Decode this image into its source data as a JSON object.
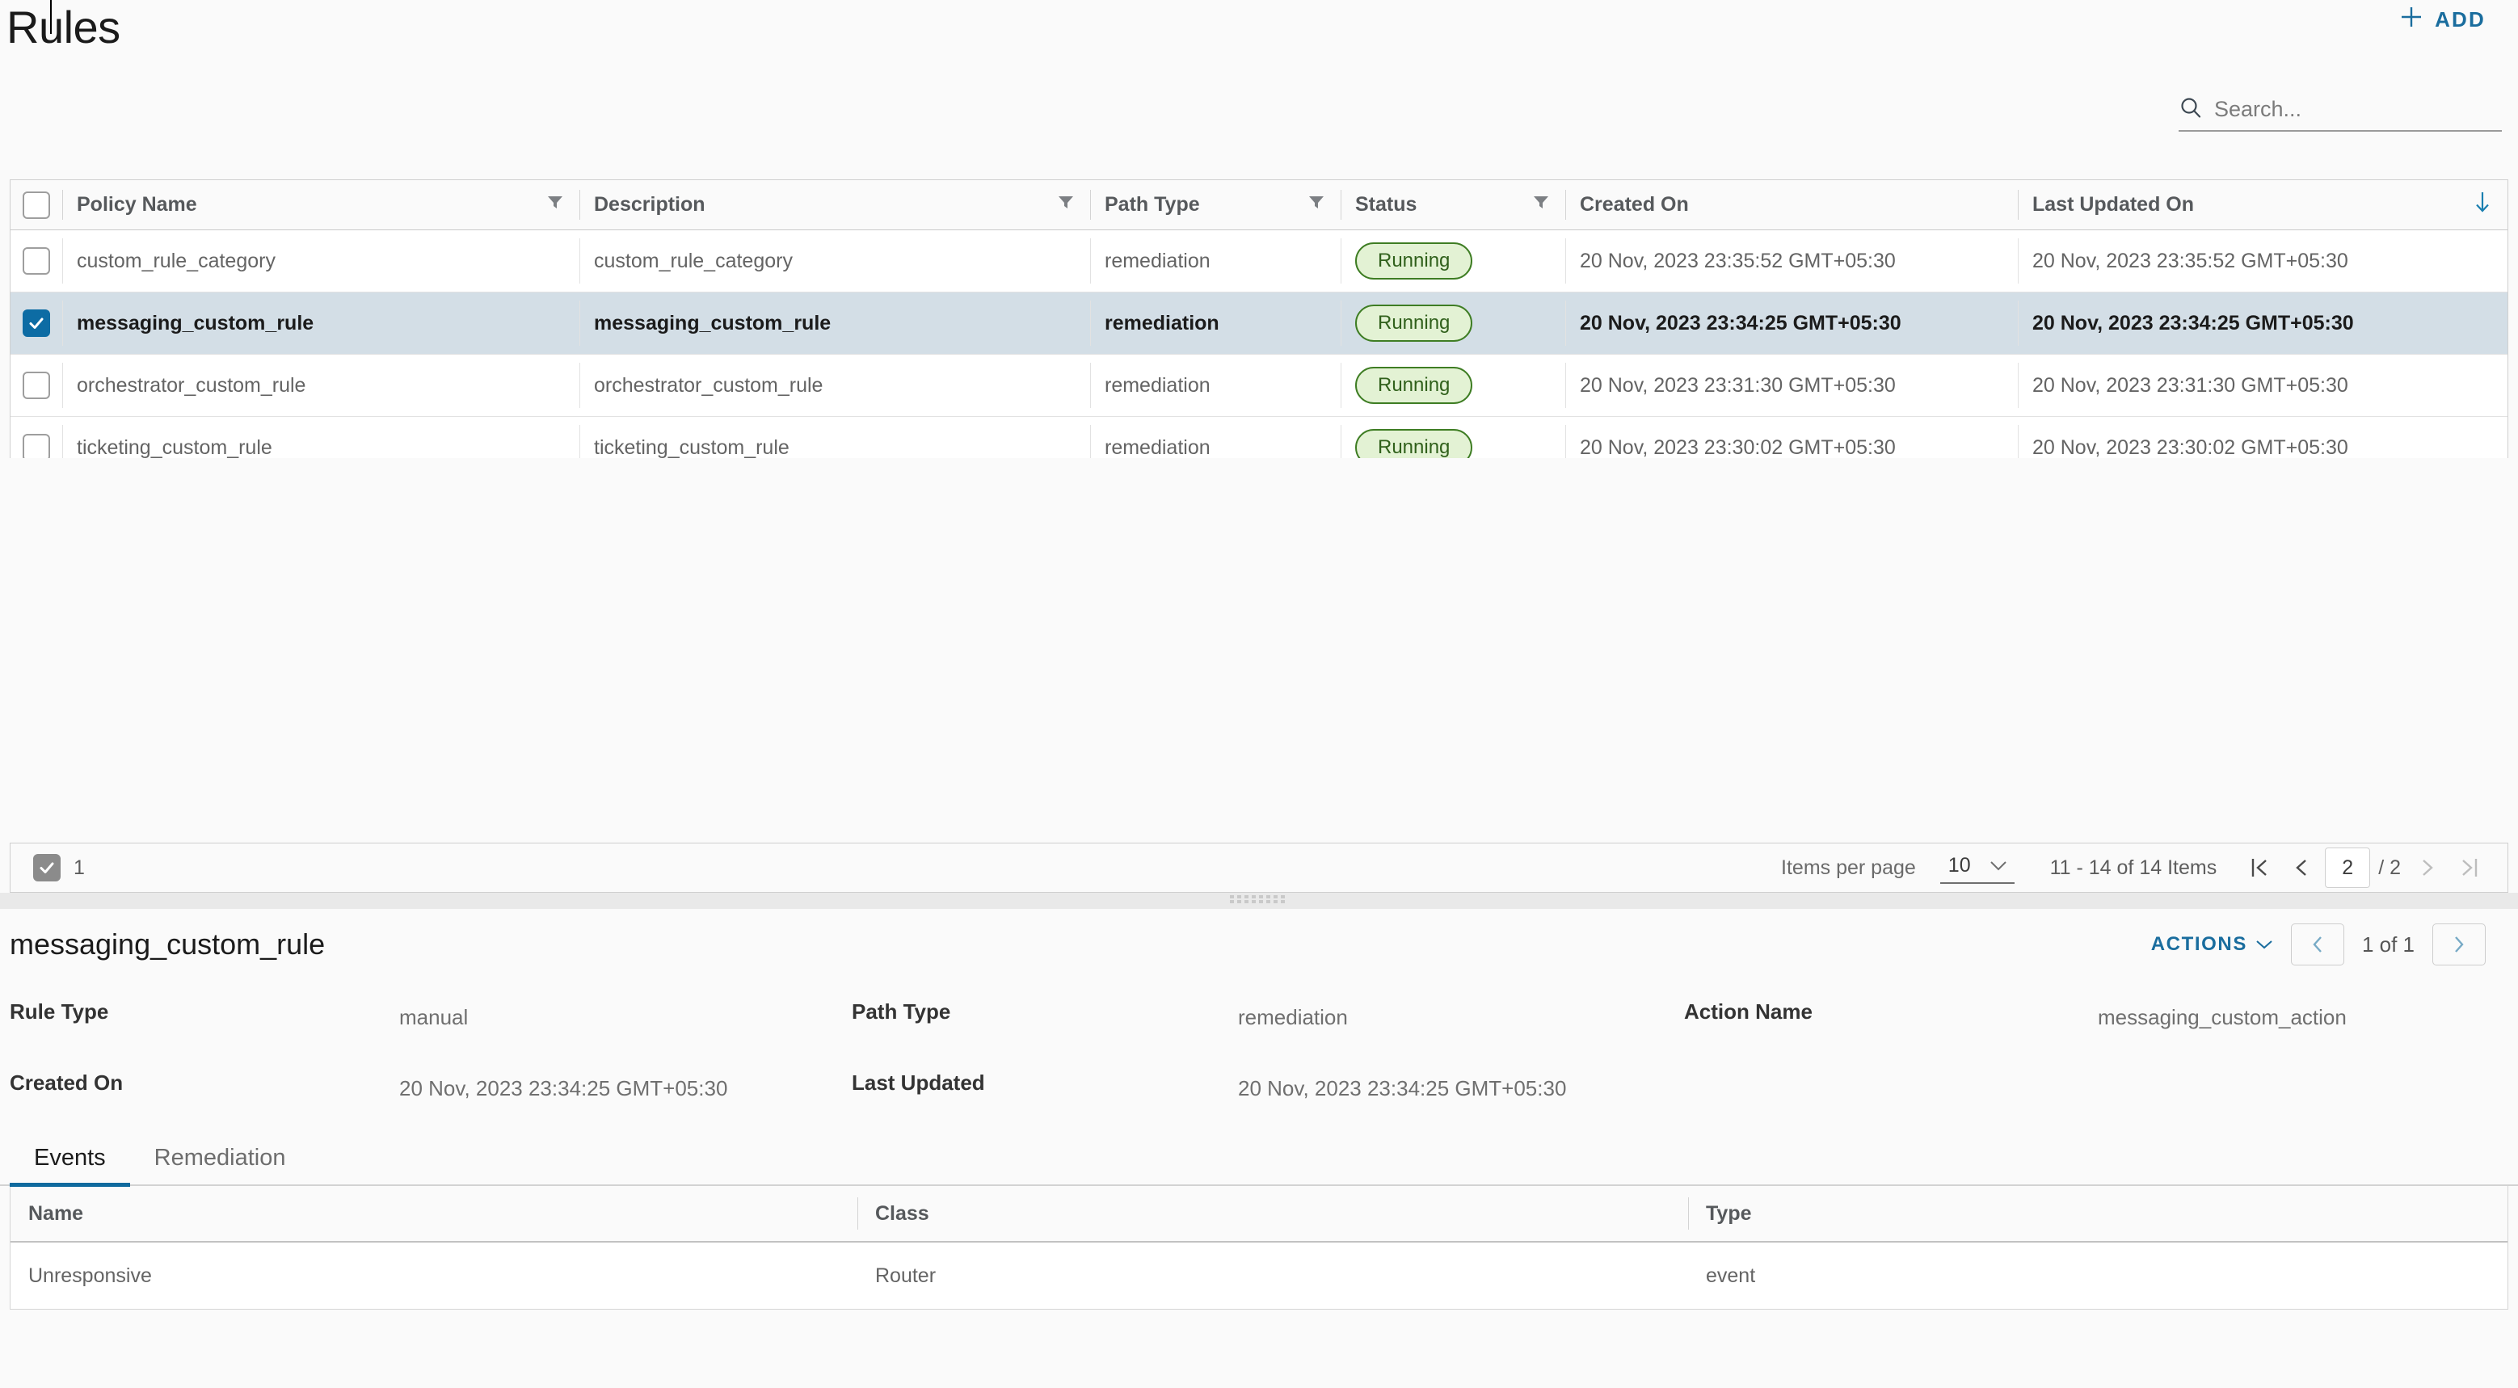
{
  "header": {
    "title": "Rules",
    "add_label": "ADD",
    "add_icon": "plus-icon"
  },
  "search": {
    "placeholder": "Search...",
    "value": "",
    "icon": "search-icon"
  },
  "colors": {
    "accent": "#1a6d9e",
    "selected_row": "#d3dee6",
    "checkbox_checked": "#0d6ca4",
    "status_bg": "#e3f2d4",
    "status_border": "#3e7d23",
    "status_text": "#30601b",
    "tab_active_underline": "#0f6a9e"
  },
  "table": {
    "columns": [
      {
        "key": "policy_name",
        "label": "Policy Name",
        "filterable": true,
        "sort": ""
      },
      {
        "key": "description",
        "label": "Description",
        "filterable": true,
        "sort": ""
      },
      {
        "key": "path_type",
        "label": "Path Type",
        "filterable": true,
        "sort": ""
      },
      {
        "key": "status",
        "label": "Status",
        "filterable": true,
        "sort": ""
      },
      {
        "key": "created_on",
        "label": "Created On",
        "filterable": false,
        "sort": ""
      },
      {
        "key": "last_updated",
        "label": "Last Updated On",
        "filterable": false,
        "sort": "desc"
      }
    ],
    "rows": [
      {
        "selected": false,
        "policy_name": "custom_rule_category",
        "description": "custom_rule_category",
        "path_type": "remediation",
        "status": "Running",
        "created_on": "20 Nov, 2023 23:35:52 GMT+05:30",
        "last_updated": "20 Nov, 2023 23:35:52 GMT+05:30"
      },
      {
        "selected": true,
        "policy_name": "messaging_custom_rule",
        "description": "messaging_custom_rule",
        "path_type": "remediation",
        "status": "Running",
        "created_on": "20 Nov, 2023 23:34:25 GMT+05:30",
        "last_updated": "20 Nov, 2023 23:34:25 GMT+05:30"
      },
      {
        "selected": false,
        "policy_name": "orchestrator_custom_rule",
        "description": "orchestrator_custom_rule",
        "path_type": "remediation",
        "status": "Running",
        "created_on": "20 Nov, 2023 23:31:30 GMT+05:30",
        "last_updated": "20 Nov, 2023 23:31:30 GMT+05:30"
      },
      {
        "selected": false,
        "policy_name": "ticketing_custom_rule",
        "description": "ticketing_custom_rule",
        "path_type": "remediation",
        "status": "Running",
        "created_on": "20 Nov, 2023 23:30:02 GMT+05:30",
        "last_updated": "20 Nov, 2023 23:30:02 GMT+05:30"
      }
    ]
  },
  "footer": {
    "selected_count": "1",
    "items_per_page_label": "Items per page",
    "items_per_page_value": "10",
    "range_label": "11 - 14 of 14 Items",
    "page_value": "2",
    "page_total": "/ 2"
  },
  "detail": {
    "title": "messaging_custom_rule",
    "actions_label": "ACTIONS",
    "nav_count": "1 of 1",
    "fields": [
      {
        "label": "Rule Type",
        "value": "manual"
      },
      {
        "label": "Path Type",
        "value": "remediation"
      },
      {
        "label": "Action Name",
        "value": "messaging_custom_action"
      },
      {
        "label": "Created On",
        "value": "20 Nov, 2023 23:34:25 GMT+05:30"
      },
      {
        "label": "Last Updated",
        "value": "20 Nov, 2023 23:34:25 GMT+05:30"
      }
    ],
    "tabs": [
      {
        "label": "Events",
        "active": true
      },
      {
        "label": "Remediation",
        "active": false
      }
    ],
    "events_table": {
      "columns": [
        "Name",
        "Class",
        "Type"
      ],
      "rows": [
        {
          "name": "Unresponsive",
          "class": "Router",
          "type": "event"
        }
      ]
    }
  }
}
